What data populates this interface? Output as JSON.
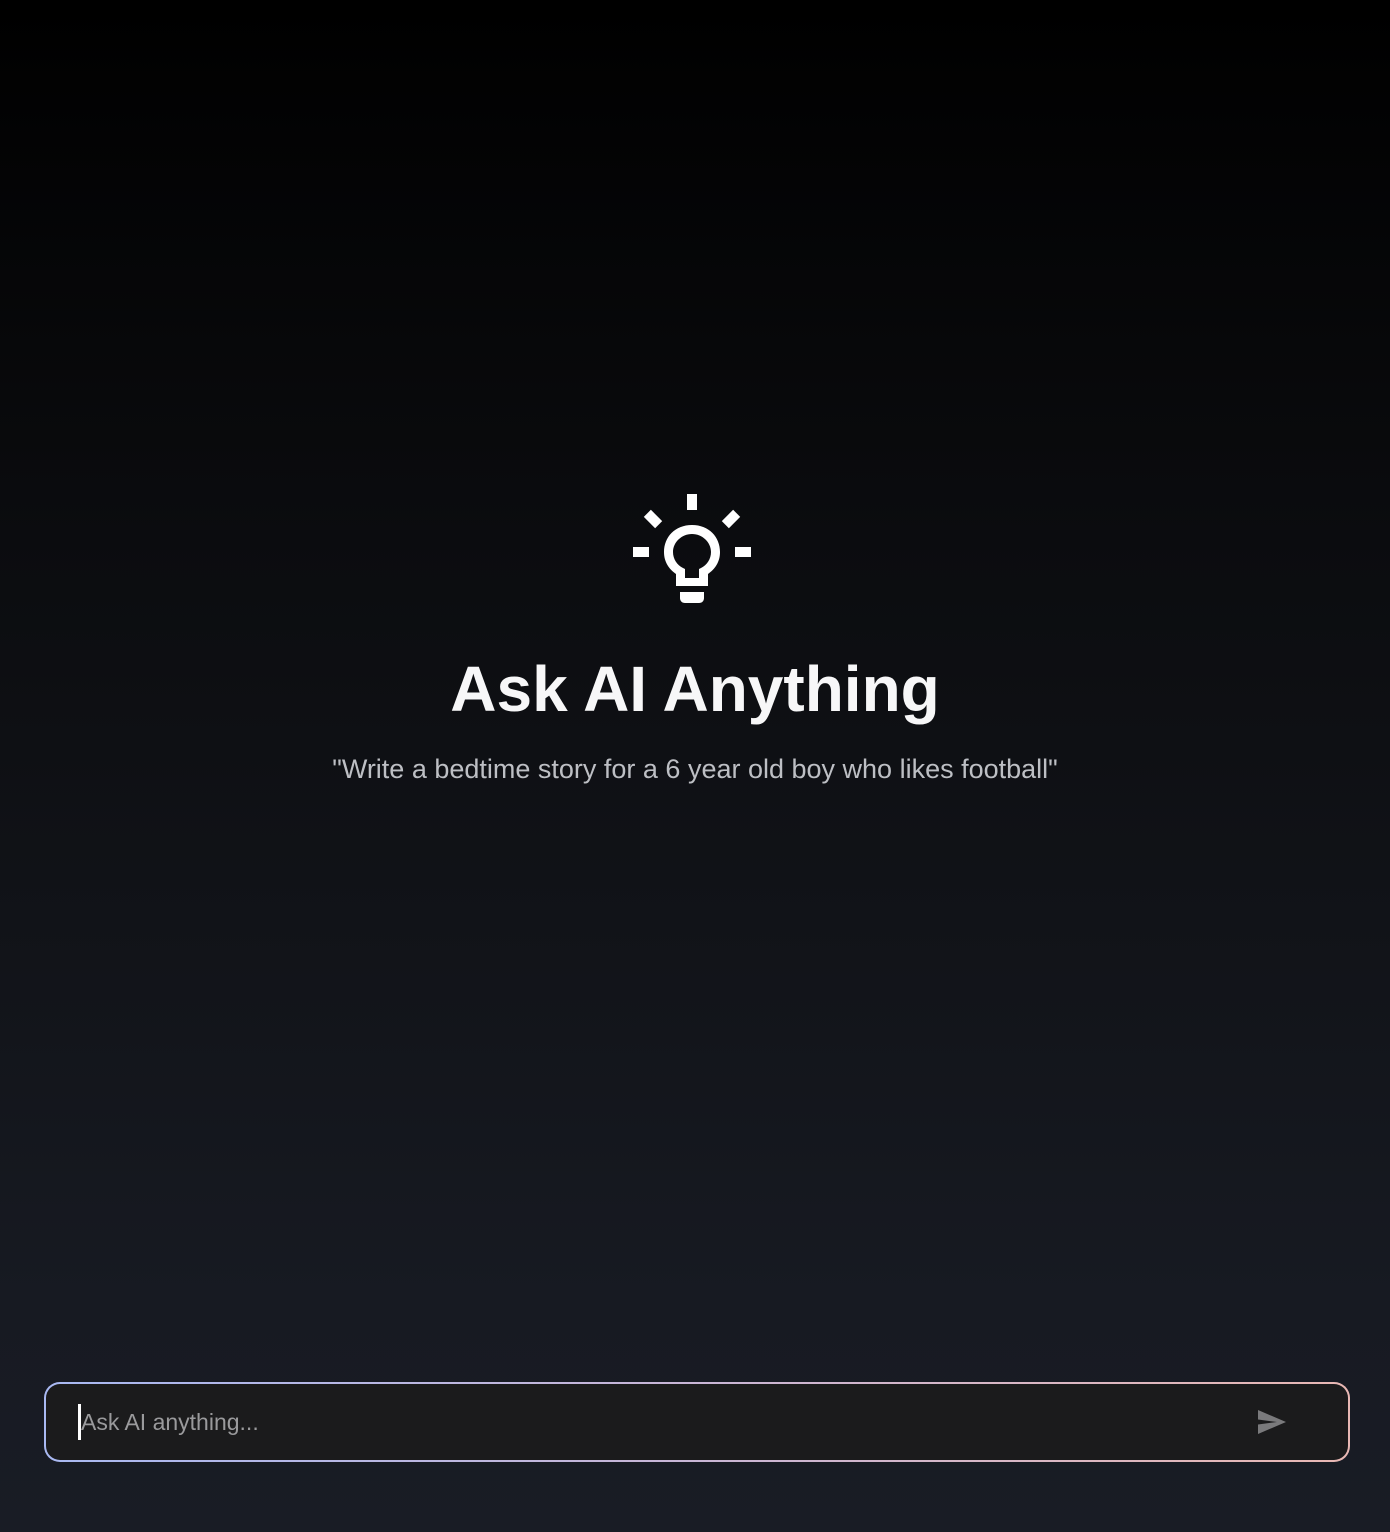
{
  "hero": {
    "icon": "lightbulb-icon",
    "title": "Ask AI Anything",
    "subtitle": "\"Write a bedtime story for a 6 year old boy who likes football\""
  },
  "composer": {
    "placeholder": "Ask AI anything...",
    "value": "",
    "send_icon": "send-icon"
  },
  "colors": {
    "background_top": "#000000",
    "background_bottom": "#191c25",
    "input_border_start": "#a9b9f2",
    "input_border_end": "#e9b8b4",
    "input_background": "#1b1b1c"
  }
}
